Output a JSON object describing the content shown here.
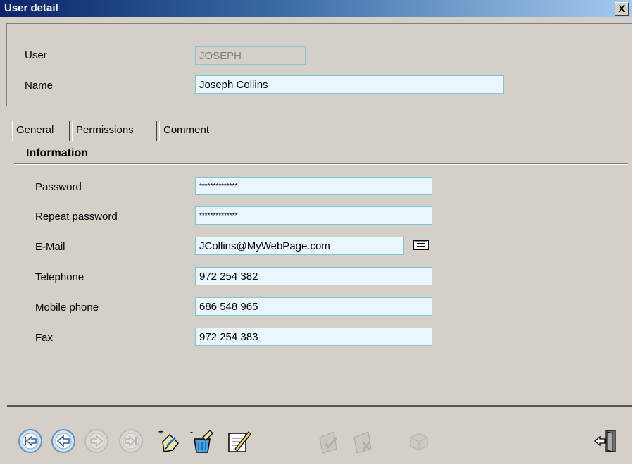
{
  "window": {
    "title": "User detail",
    "close_label": "X"
  },
  "header": {
    "user_label": "User",
    "user_value": "JOSEPH",
    "name_label": "Name",
    "name_value": "Joseph Collins"
  },
  "tabs": [
    {
      "label": "General",
      "active": true
    },
    {
      "label": "Permissions",
      "active": false
    },
    {
      "label": "Comment",
      "active": false
    }
  ],
  "information": {
    "group_title": "Information",
    "password_label": "Password",
    "password_value": "**************",
    "repeat_password_label": "Repeat password",
    "repeat_password_value": "**************",
    "email_label": "E-Mail",
    "email_value": "JCollins@MyWebPage.com",
    "telephone_label": "Telephone",
    "telephone_value": "972 254 382",
    "mobile_label": "Mobile phone",
    "mobile_value": "686 548 965",
    "fax_label": "Fax",
    "fax_value": "972 254 383"
  },
  "toolbar": {
    "icons": [
      "first-record-icon",
      "previous-record-icon",
      "next-record-icon",
      "last-record-icon",
      "new-record-icon",
      "delete-record-icon",
      "edit-record-icon",
      "confirm-icon",
      "cancel-icon",
      "print-icon",
      "exit-icon"
    ]
  },
  "colors": {
    "field_bg": "#eaf6fd",
    "field_border": "#7fc4dc",
    "window_bg": "#d4d0c8",
    "title_start": "#0a246a",
    "title_end": "#a6caf0"
  }
}
